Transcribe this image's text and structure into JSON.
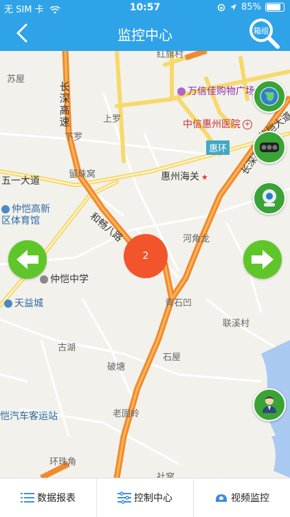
{
  "status": {
    "carrier": "无 SIM 卡",
    "time": "10:57",
    "battery": "85%"
  },
  "nav": {
    "title": "监控中心",
    "search_label": "箱组"
  },
  "map": {
    "labels": {
      "gonghong": "红旗村",
      "suwu": "苏屋",
      "wanxin": "万信佳购物广场",
      "shangluo": "上罗",
      "zhongxin": "中信惠州医院",
      "xialuo": "下罗",
      "huihuan": "惠环",
      "liuzhuwo": "留珠窝",
      "wuyidadao": "五一大道",
      "huizhouhaiguan": "惠州海关",
      "zhongkai_gym": "仲恺高新区体育馆",
      "hejiaolong": "河角龙",
      "zhongkai_school": "仲恺中学",
      "tianyicheng": "天益城",
      "qingshiao": "青石凹",
      "lianxicun": "联溪村",
      "guhu": "古湖",
      "potang": "破塘",
      "shiwu": "石屋",
      "bus_station": "恺汽车客运站",
      "laoguling": "老固岭",
      "huanzhujiao": "环珠角",
      "shewu": "社窝",
      "road_changshen_left": "长深高速",
      "road_hechang": "和畅八路",
      "road_changshen_right": "长深高速",
      "road_zhongkai": "仲恺大道"
    },
    "cluster_count": "2"
  },
  "tabs": [
    {
      "label": "数据报表"
    },
    {
      "label": "控制中心"
    },
    {
      "label": "视频监控"
    }
  ]
}
